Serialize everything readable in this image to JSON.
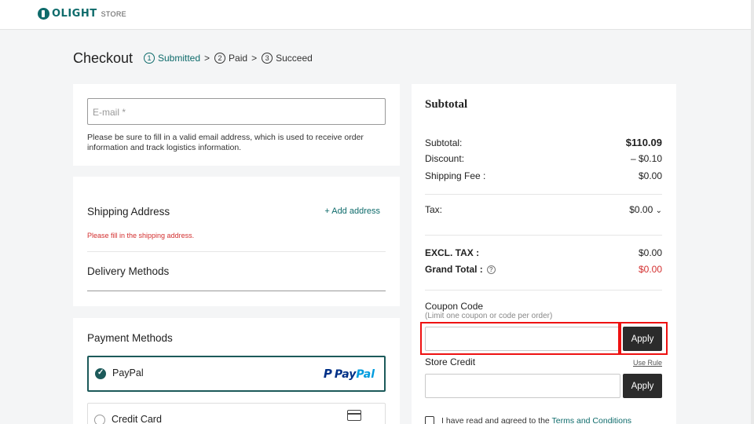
{
  "brand": {
    "logo_text": "OLIGHT",
    "store_label": "STORE"
  },
  "page": {
    "title": "Checkout"
  },
  "steps": [
    {
      "num": "1",
      "label": "Submitted"
    },
    {
      "num": "2",
      "label": "Paid"
    },
    {
      "num": "3",
      "label": "Succeed"
    }
  ],
  "email": {
    "placeholder": "E-mail *",
    "note": "Please be sure to fill in a valid email address, which is used to receive order information and track logistics information."
  },
  "shipping": {
    "title": "Shipping Address",
    "add_label": "+ Add address",
    "error": "Please fill in the shipping address.",
    "delivery_title": "Delivery Methods"
  },
  "payment": {
    "title": "Payment Methods",
    "options": [
      {
        "label": "PayPal",
        "selected": true,
        "logo_a": "Pay",
        "logo_b": "Pal"
      },
      {
        "label": "Credit Card",
        "selected": false
      }
    ]
  },
  "summary": {
    "title": "Subtotal",
    "subtotal_label": "Subtotal:",
    "subtotal_value": "$110.09",
    "discount_label": "Discount:",
    "discount_value": "– $0.10",
    "shipping_label": "Shipping Fee :",
    "shipping_value": "$0.00",
    "tax_label": "Tax:",
    "tax_value": "$0.00",
    "excl_label": "EXCL. TAX :",
    "excl_value": "$0.00",
    "grand_label": "Grand Total :",
    "grand_value": "$0.00",
    "coupon_title": "Coupon Code",
    "coupon_sub": "(Limit one coupon or code per order)",
    "apply_label": "Apply",
    "credit_title": "Store Credit",
    "use_rule": "Use Rule",
    "terms_text": "I have read and agreed to the ",
    "terms_link": "Terms and Conditions"
  },
  "colors": {
    "accent": "#0e6b6b",
    "error": "#d32f2f",
    "button": "#2b2b2b",
    "highlight": "#ee1111"
  }
}
